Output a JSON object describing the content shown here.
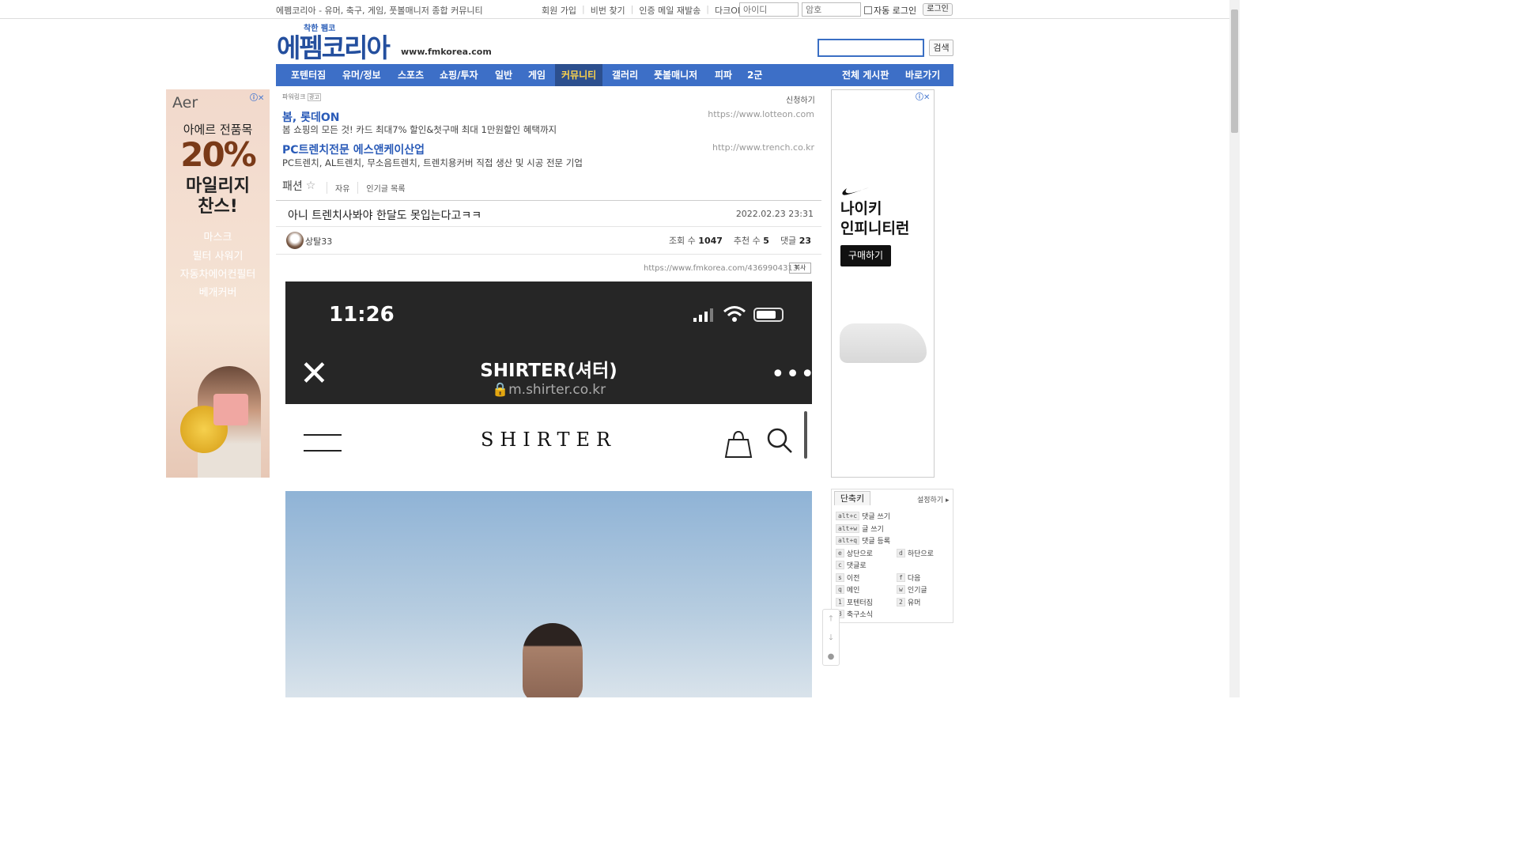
{
  "topbar": {
    "slogan": "에펨코리아 - 유머, 축구, 게임, 풋볼매니저 종합 커뮤니티",
    "links": [
      "회원 가입",
      "비번 찾기",
      "인증 메일 재발송",
      "다크OFF"
    ],
    "id_placeholder": "아이디",
    "pw_placeholder": "암호",
    "auto_login": "자동 로그인",
    "login": "로그인"
  },
  "logo": {
    "tagline": "착한 펨코",
    "name": "에펨코리아",
    "domain": "www.fmkorea.com"
  },
  "search": {
    "button": "검색",
    "value": ""
  },
  "nav": {
    "items": [
      "포텐터짐",
      "유머/정보",
      "스포츠",
      "쇼핑/투자",
      "일반",
      "게임",
      "커뮤니티",
      "갤러리",
      "풋볼매니저",
      "피파",
      "2군"
    ],
    "active": "커뮤니티",
    "right": [
      "전체 게시판",
      "바로가기"
    ]
  },
  "left_ad": {
    "brand": "Aer",
    "line1": "아에르 전품목",
    "big": "20%",
    "line2": "마일리지",
    "line3": "찬스!",
    "items": [
      "마스크",
      "필터 사워기",
      "자동차에어컨필터",
      "베개커버"
    ]
  },
  "right_ad": {
    "title1": "나이키",
    "title2": "인피니티런",
    "cta": "구매하기"
  },
  "powerlink": {
    "label": "파워링크",
    "ad_tag": "광고",
    "apply": "신청하기",
    "ads": [
      {
        "title": "봄, 롯데ON",
        "url": "https://www.lotteon.com",
        "desc": "봄 쇼핑의 모든 것! 카드 최대7% 할인&첫구매 최대 1만원할인 혜택까지"
      },
      {
        "title": "PC트렌치전문 에스앤케이산업",
        "url": "http://www.trench.co.kr",
        "desc": "PC트렌치, AL트렌치, 무소음트렌치, 트렌치용커버 직접 생산 및 시공 전문 기업"
      }
    ]
  },
  "board": {
    "name": "패션",
    "links": [
      "자유",
      "인기글 목록"
    ]
  },
  "post": {
    "title": "아니 트렌치사봐야 한달도 못입는다고ㅋㅋ",
    "date": "2022.02.23 23:31",
    "author": "상탈33",
    "views_label": "조회 수",
    "views": "1047",
    "votes_label": "추천 수",
    "votes": "5",
    "comments_label": "댓글",
    "comments": "23",
    "url": "https://www.fmkorea.com/4369904313",
    "copy": "복사"
  },
  "phone": {
    "time": "11:26",
    "site_name": "SHIRTER(셔터)",
    "site_url": "m.shirter.co.kr",
    "logo": "SHIRTER"
  },
  "shortcut": {
    "tab": "단축키",
    "setting": "설정하기",
    "keys": [
      {
        "key": "alt+c",
        "label": "댓글 쓰기"
      },
      {
        "key": "alt+w",
        "label": "글 쓰기"
      },
      {
        "key": "alt+q",
        "label": "댓글 등록"
      },
      {
        "key": "e",
        "label": "상단으로"
      },
      {
        "key": "d",
        "label": "하단으로"
      },
      {
        "key": "c",
        "label": "댓글로"
      },
      {
        "key": "s",
        "label": "이전"
      },
      {
        "key": "f",
        "label": "다음"
      },
      {
        "key": "q",
        "label": "메인"
      },
      {
        "key": "w",
        "label": "인기글"
      },
      {
        "key": "1",
        "label": "포텐터짐"
      },
      {
        "key": "2",
        "label": "유머"
      },
      {
        "key": "3",
        "label": "축구소식"
      }
    ]
  },
  "colors": {
    "nav": "#3d6fc7",
    "nav_active_text": "#ffd54a",
    "link": "#2a5bb8"
  }
}
